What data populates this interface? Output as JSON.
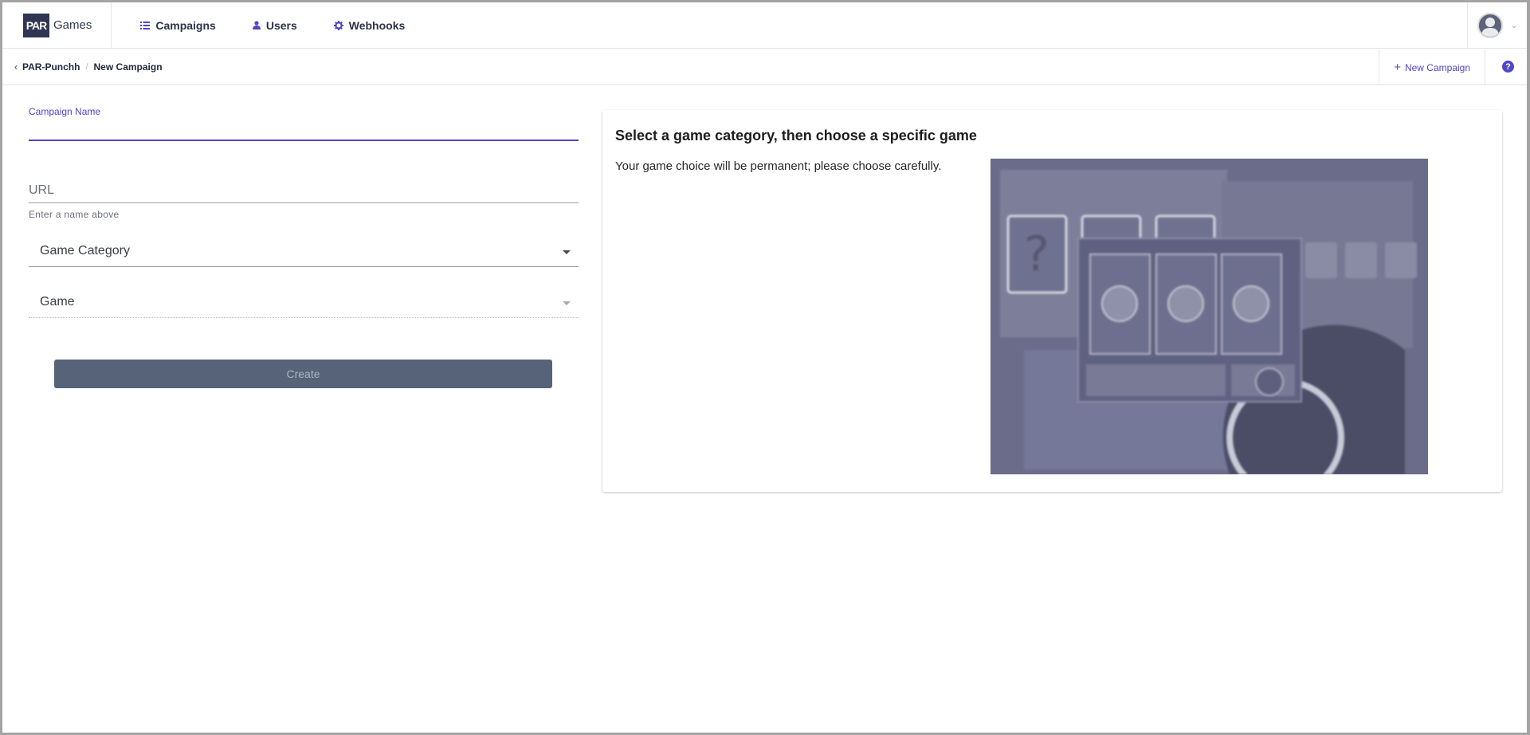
{
  "brand": {
    "logo_text": "PAR",
    "name": "Games"
  },
  "nav": [
    {
      "label": "Campaigns",
      "icon": "list-icon"
    },
    {
      "label": "Users",
      "icon": "user-icon"
    },
    {
      "label": "Webhooks",
      "icon": "gear-icon"
    }
  ],
  "user_menu": {
    "icon": "avatar-icon",
    "caret_icon": "chevron-down-icon"
  },
  "breadcrumb": {
    "back_icon": "chevron-left-icon",
    "parent": "PAR-Punchh",
    "separator": "/",
    "current": "New Campaign"
  },
  "actions": {
    "new_campaign": "New Campaign",
    "help": "?"
  },
  "form": {
    "campaign_name_label": "Campaign Name",
    "campaign_name_value": "",
    "url_placeholder": "URL",
    "url_helper": "Enter a name above",
    "game_category": "Game Category",
    "game": "Game",
    "create_label": "Create"
  },
  "info": {
    "title": "Select a game category, then choose a specific game",
    "text": "Your game choice will be permanent; please choose carefully."
  },
  "colors": {
    "accent": "#4f46c8",
    "brand_dark": "#2f3552",
    "button_disabled": "#566379"
  }
}
